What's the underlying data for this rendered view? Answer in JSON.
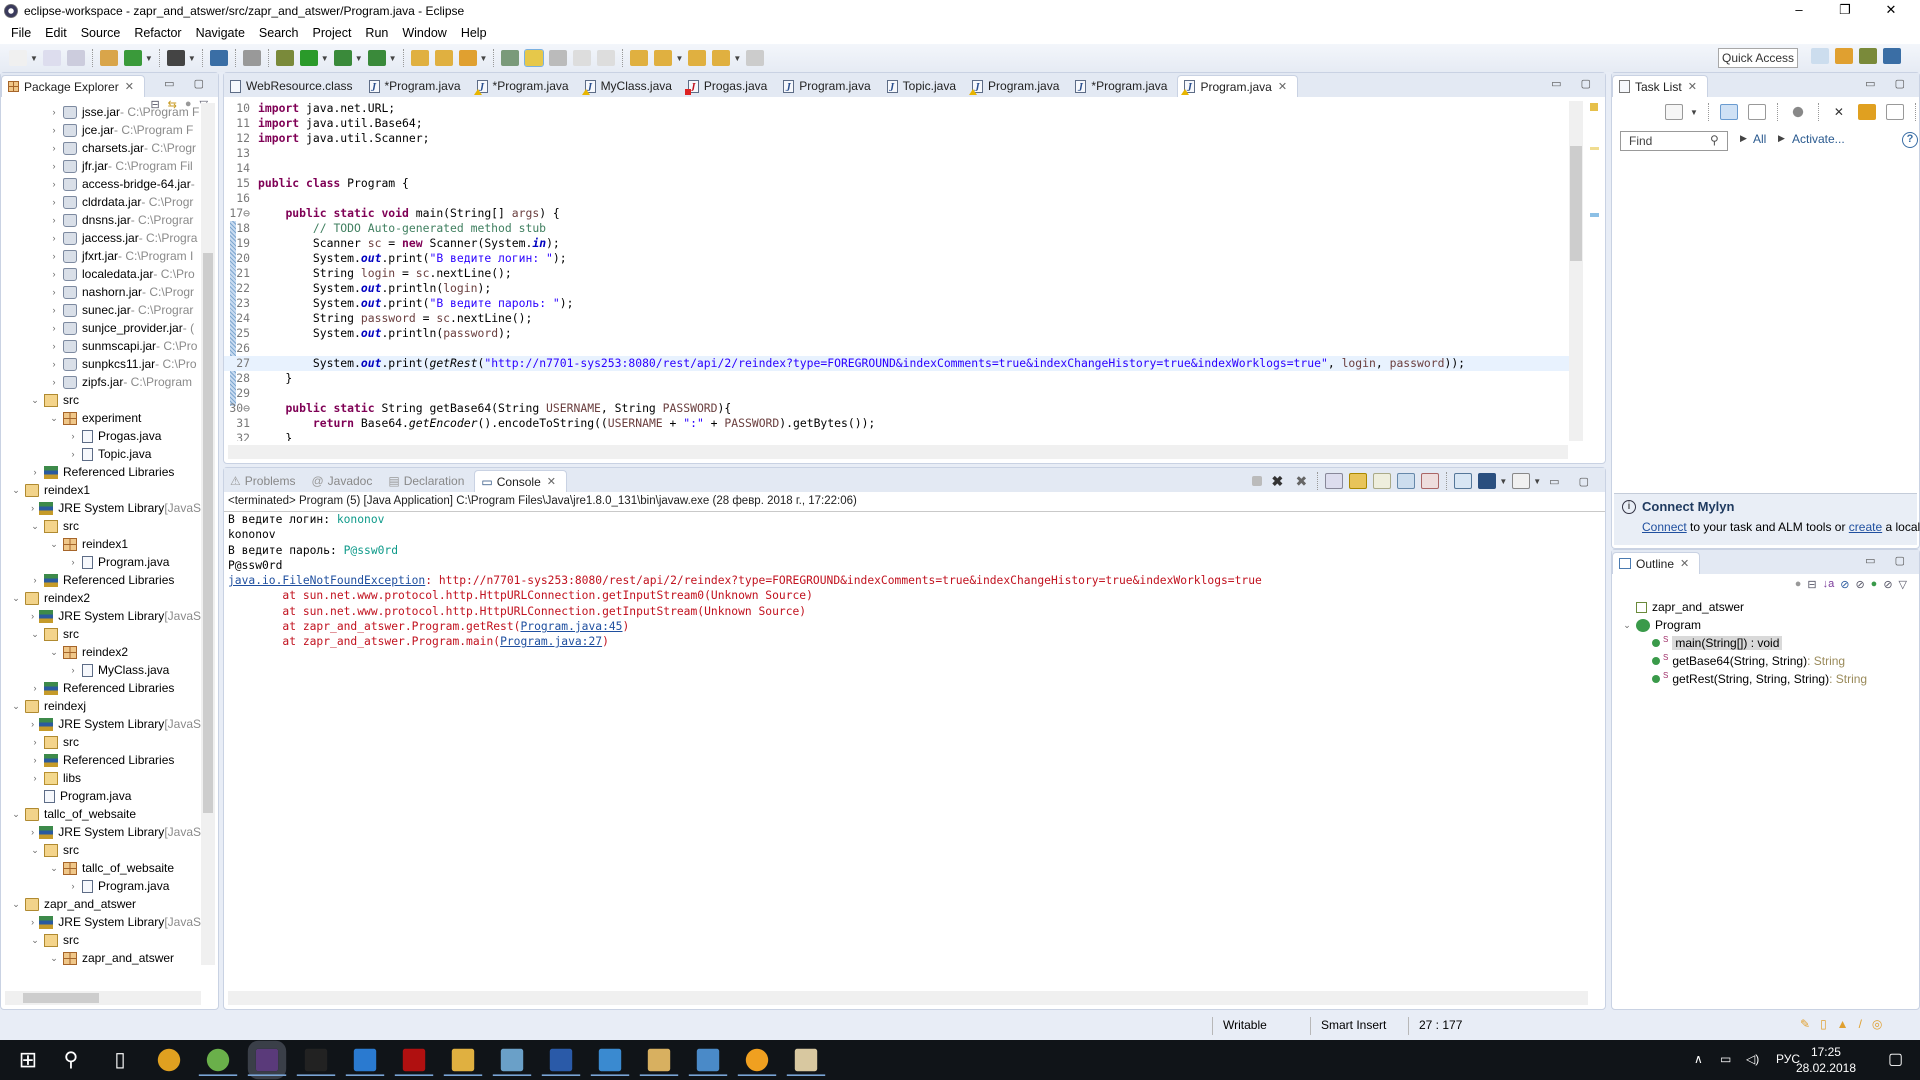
{
  "window": {
    "title": "eclipse-workspace - zapr_and_atswer/src/zapr_and_atswer/Program.java - Eclipse",
    "controls": {
      "minimize": "–",
      "maximize": "❐",
      "close": "✕"
    }
  },
  "menu": [
    "File",
    "Edit",
    "Source",
    "Refactor",
    "Navigate",
    "Search",
    "Project",
    "Run",
    "Window",
    "Help"
  ],
  "toolbar": {
    "quick_access": "Quick Access",
    "icons": [
      "new-icon",
      "save-icon",
      "save-all-icon",
      "new-package-icon",
      "new-class-icon",
      "profile-icon",
      "console-icon",
      "skip-breakpoints-icon",
      "debug-icon",
      "run-icon",
      "coverage-icon",
      "external-tools-icon",
      "open-type-icon",
      "open-task-icon",
      "search-icon",
      "annotation-icon",
      "mark-occurrences-icon",
      "show-whitespace-icon",
      "word-wrap-icon",
      "block-select-icon",
      "next-annotation-icon",
      "prev-annotation-icon",
      "last-edit-icon",
      "back-icon",
      "forward-icon"
    ],
    "perspectives": [
      "open-perspective-icon",
      "java-ee-icon",
      "debug-perspective-icon",
      "java-perspective-icon"
    ]
  },
  "package_explorer": {
    "title": "Package Explorer",
    "tree": [
      {
        "depth": 2,
        "arrow": "›",
        "icon": "jar",
        "label": "jsse.jar",
        "suffix": " - C:\\Program F"
      },
      {
        "depth": 2,
        "arrow": "›",
        "icon": "jar",
        "label": "jce.jar",
        "suffix": " - C:\\Program F"
      },
      {
        "depth": 2,
        "arrow": "›",
        "icon": "jar",
        "label": "charsets.jar",
        "suffix": " - C:\\Progr"
      },
      {
        "depth": 2,
        "arrow": "›",
        "icon": "jar",
        "label": "jfr.jar",
        "suffix": " - C:\\Program Fil"
      },
      {
        "depth": 2,
        "arrow": "›",
        "icon": "jar",
        "label": "access-bridge-64.jar",
        "suffix": " -"
      },
      {
        "depth": 2,
        "arrow": "›",
        "icon": "jar",
        "label": "cldrdata.jar",
        "suffix": " - C:\\Progr"
      },
      {
        "depth": 2,
        "arrow": "›",
        "icon": "jar",
        "label": "dnsns.jar",
        "suffix": " - C:\\Prograr"
      },
      {
        "depth": 2,
        "arrow": "›",
        "icon": "jar",
        "label": "jaccess.jar",
        "suffix": " - C:\\Progra"
      },
      {
        "depth": 2,
        "arrow": "›",
        "icon": "jar",
        "label": "jfxrt.jar",
        "suffix": " - C:\\Program I"
      },
      {
        "depth": 2,
        "arrow": "›",
        "icon": "jar",
        "label": "localedata.jar",
        "suffix": " - C:\\Pro"
      },
      {
        "depth": 2,
        "arrow": "›",
        "icon": "jar",
        "label": "nashorn.jar",
        "suffix": " - C:\\Progr"
      },
      {
        "depth": 2,
        "arrow": "›",
        "icon": "jar",
        "label": "sunec.jar",
        "suffix": " - C:\\Prograr"
      },
      {
        "depth": 2,
        "arrow": "›",
        "icon": "jar",
        "label": "sunjce_provider.jar",
        "suffix": " - ("
      },
      {
        "depth": 2,
        "arrow": "›",
        "icon": "jar",
        "label": "sunmscapi.jar",
        "suffix": " - C:\\Pro"
      },
      {
        "depth": 2,
        "arrow": "›",
        "icon": "jar",
        "label": "sunpkcs11.jar",
        "suffix": " - C:\\Pro"
      },
      {
        "depth": 2,
        "arrow": "›",
        "icon": "jar",
        "label": "zipfs.jar",
        "suffix": " - C:\\Program"
      },
      {
        "depth": 1,
        "arrow": "⌄",
        "icon": "src",
        "label": "src",
        "suffix": ""
      },
      {
        "depth": 2,
        "arrow": "⌄",
        "icon": "pkg",
        "label": "experiment",
        "suffix": ""
      },
      {
        "depth": 3,
        "arrow": "›",
        "icon": "java",
        "label": "Progas.java",
        "suffix": ""
      },
      {
        "depth": 3,
        "arrow": "›",
        "icon": "java",
        "label": "Topic.java",
        "suffix": ""
      },
      {
        "depth": 1,
        "arrow": "›",
        "icon": "lib",
        "label": "Referenced Libraries",
        "suffix": ""
      },
      {
        "depth": 0,
        "arrow": "⌄",
        "icon": "proj",
        "label": "reindex1",
        "suffix": ""
      },
      {
        "depth": 1,
        "arrow": "›",
        "icon": "lib",
        "label": "JRE System Library",
        "suffix": " [JavaS"
      },
      {
        "depth": 1,
        "arrow": "⌄",
        "icon": "src",
        "label": "src",
        "suffix": ""
      },
      {
        "depth": 2,
        "arrow": "⌄",
        "icon": "pkg",
        "label": "reindex1",
        "suffix": ""
      },
      {
        "depth": 3,
        "arrow": "›",
        "icon": "java",
        "label": "Program.java",
        "suffix": ""
      },
      {
        "depth": 1,
        "arrow": "›",
        "icon": "lib",
        "label": "Referenced Libraries",
        "suffix": ""
      },
      {
        "depth": 0,
        "arrow": "⌄",
        "icon": "proj",
        "label": "reindex2",
        "suffix": ""
      },
      {
        "depth": 1,
        "arrow": "›",
        "icon": "lib",
        "label": "JRE System Library",
        "suffix": " [JavaS"
      },
      {
        "depth": 1,
        "arrow": "⌄",
        "icon": "src",
        "label": "src",
        "suffix": ""
      },
      {
        "depth": 2,
        "arrow": "⌄",
        "icon": "pkg",
        "label": "reindex2",
        "suffix": ""
      },
      {
        "depth": 3,
        "arrow": "›",
        "icon": "java",
        "label": "MyClass.java",
        "suffix": ""
      },
      {
        "depth": 1,
        "arrow": "›",
        "icon": "lib",
        "label": "Referenced Libraries",
        "suffix": ""
      },
      {
        "depth": 0,
        "arrow": "⌄",
        "icon": "proj",
        "label": "reindexj",
        "suffix": ""
      },
      {
        "depth": 1,
        "arrow": "›",
        "icon": "lib",
        "label": "JRE System Library",
        "suffix": " [JavaS"
      },
      {
        "depth": 1,
        "arrow": "›",
        "icon": "src",
        "label": "src",
        "suffix": ""
      },
      {
        "depth": 1,
        "arrow": "›",
        "icon": "lib",
        "label": "Referenced Libraries",
        "suffix": ""
      },
      {
        "depth": 1,
        "arrow": "›",
        "icon": "folder",
        "label": "libs",
        "suffix": ""
      },
      {
        "depth": 1,
        "arrow": "",
        "icon": "java",
        "label": "Program.java",
        "suffix": ""
      },
      {
        "depth": 0,
        "arrow": "⌄",
        "icon": "proj",
        "label": "tallc_of_websaite",
        "suffix": ""
      },
      {
        "depth": 1,
        "arrow": "›",
        "icon": "lib",
        "label": "JRE System Library",
        "suffix": " [JavaS"
      },
      {
        "depth": 1,
        "arrow": "⌄",
        "icon": "src",
        "label": "src",
        "suffix": ""
      },
      {
        "depth": 2,
        "arrow": "⌄",
        "icon": "pkg",
        "label": "tallc_of_websaite",
        "suffix": ""
      },
      {
        "depth": 3,
        "arrow": "›",
        "icon": "java",
        "label": "Program.java",
        "suffix": ""
      },
      {
        "depth": 0,
        "arrow": "⌄",
        "icon": "proj",
        "label": "zapr_and_atswer",
        "suffix": ""
      },
      {
        "depth": 1,
        "arrow": "›",
        "icon": "lib",
        "label": "JRE System Library",
        "suffix": " [JavaS"
      },
      {
        "depth": 1,
        "arrow": "⌄",
        "icon": "src",
        "label": "src",
        "suffix": ""
      },
      {
        "depth": 2,
        "arrow": "⌄",
        "icon": "pkg",
        "label": "zapr_and_atswer",
        "suffix": ""
      }
    ]
  },
  "editor": {
    "tabs": [
      {
        "label": "WebResource.class",
        "icon": "class",
        "dirty": false,
        "active": false
      },
      {
        "label": "*Program.java",
        "icon": "java",
        "active": false
      },
      {
        "label": "*Program.java",
        "icon": "java-warn",
        "active": false
      },
      {
        "label": "MyClass.java",
        "icon": "java-warn",
        "active": false
      },
      {
        "label": "Progas.java",
        "icon": "java-err",
        "active": false
      },
      {
        "label": "Program.java",
        "icon": "java",
        "active": false
      },
      {
        "label": "Topic.java",
        "icon": "java",
        "active": false
      },
      {
        "label": "Program.java",
        "icon": "java-warn",
        "active": false
      },
      {
        "label": "*Program.java",
        "icon": "java",
        "active": false
      },
      {
        "label": "Program.java",
        "icon": "java-warn",
        "active": true
      }
    ],
    "lines": [
      {
        "n": "10",
        "html": "<span class='kw'>import</span> java.net.URL;"
      },
      {
        "n": "11",
        "html": "<span class='kw'>import</span> java.util.Base64;"
      },
      {
        "n": "12",
        "html": "<span class='kw'>import</span> java.util.Scanner;"
      },
      {
        "n": "13",
        "html": ""
      },
      {
        "n": "14",
        "html": ""
      },
      {
        "n": "15",
        "html": "<span class='kw'>public class</span> Program {"
      },
      {
        "n": "16",
        "html": ""
      },
      {
        "n": "17⊖",
        "html": "    <span class='kw'>public static void</span> main(String[] <span class='var'>args</span>) {"
      },
      {
        "n": "18",
        "html": "        <span class='cm'>// TODO Auto-generated method stub</span>"
      },
      {
        "n": "19",
        "html": "        Scanner <span class='var'>sc</span> = <span class='kw'>new</span> Scanner(System.<span class='fld'>in</span>);"
      },
      {
        "n": "20",
        "html": "        System.<span class='fld'>out</span>.print(<span class='str'>\"В ведите логин: \"</span>);"
      },
      {
        "n": "21",
        "html": "        String <span class='var'>login</span> = <span class='var'>sc</span>.nextLine();"
      },
      {
        "n": "22",
        "html": "        System.<span class='fld'>out</span>.println(<span class='var'>login</span>);"
      },
      {
        "n": "23",
        "html": "        System.<span class='fld'>out</span>.print(<span class='str'>\"В ведите пароль: \"</span>);"
      },
      {
        "n": "24",
        "html": "        String <span class='var'>password</span> = <span class='var'>sc</span>.nextLine();"
      },
      {
        "n": "25",
        "html": "        System.<span class='fld'>out</span>.println(<span class='var'>password</span>);"
      },
      {
        "n": "26",
        "html": ""
      },
      {
        "n": "27",
        "cur": true,
        "html": "        System.<span class='fld'>out</span>.print(<span class='it'>getRest</span>(<span class='str'>\"http://n7701-sys253:8080/rest/api/2/reindex?type=FOREGROUND&amp;indexComments=true&amp;indexChangeHistory=true&amp;indexWorklogs=true\"</span>, <span class='var'>login</span>, <span class='var'>password</span>));"
      },
      {
        "n": "28",
        "html": "    }"
      },
      {
        "n": "29",
        "html": ""
      },
      {
        "n": "30⊖",
        "html": "    <span class='kw'>public static</span> String getBase64(String <span class='var'>USERNAME</span>, String <span class='var'>PASSWORD</span>){"
      },
      {
        "n": "31",
        "html": "        <span class='kw'>return</span> Base64.<span class='it'>getEncoder</span>().encodeToString((<span class='var'>USERNAME</span> + <span class='str'>\":\"</span> + <span class='var'>PASSWORD</span>).getBytes());"
      },
      {
        "n": "32",
        "html": "    }"
      }
    ]
  },
  "bottom_panel": {
    "tabs": [
      "Problems",
      "Javadoc",
      "Declaration",
      "Console"
    ],
    "active_tab": "Console",
    "header": "<terminated> Program (5) [Java Application] C:\\Program Files\\Java\\jre1.8.0_131\\bin\\javaw.exe (28 февр. 2018 г., 17:22:06)",
    "output": [
      {
        "parts": [
          {
            "t": "В ведите логин: ",
            "c": ""
          },
          {
            "t": "kononov",
            "c": "in"
          }
        ]
      },
      {
        "parts": [
          {
            "t": "kononov",
            "c": ""
          }
        ]
      },
      {
        "parts": [
          {
            "t": "В ведите пароль: ",
            "c": ""
          },
          {
            "t": "P@ssw0rd",
            "c": "in"
          }
        ]
      },
      {
        "parts": [
          {
            "t": "P@ssw0rd",
            "c": ""
          }
        ]
      },
      {
        "parts": [
          {
            "t": "java.io.FileNotFoundException",
            "c": "link"
          },
          {
            "t": ": http://n7701-sys253:8080/rest/api/2/reindex?type=FOREGROUND&indexComments=true&indexChangeHistory=true&indexWorklogs=true",
            "c": "err"
          }
        ]
      },
      {
        "parts": [
          {
            "t": "\tat sun.net.www.protocol.http.HttpURLConnection.getInputStream0(Unknown Source)",
            "c": "err"
          }
        ]
      },
      {
        "parts": [
          {
            "t": "\tat sun.net.www.protocol.http.HttpURLConnection.getInputStream(Unknown Source)",
            "c": "err"
          }
        ]
      },
      {
        "parts": [
          {
            "t": "\tat zapr_and_atswer.Program.getRest(",
            "c": "err"
          },
          {
            "t": "Program.java:45",
            "c": "link"
          },
          {
            "t": ")",
            "c": "err"
          }
        ]
      },
      {
        "parts": [
          {
            "t": "\tat zapr_and_atswer.Program.main(",
            "c": "err"
          },
          {
            "t": "Program.java:27",
            "c": "link"
          },
          {
            "t": ")",
            "c": "err"
          }
        ]
      }
    ]
  },
  "task_list": {
    "title": "Task List",
    "find_placeholder": "Find",
    "all_label": "All",
    "activate_label": "Activate...",
    "mylyn_title": "Connect Mylyn",
    "mylyn_connect": "Connect",
    "mylyn_mid": " to your task and ALM tools or ",
    "mylyn_create": "create",
    "mylyn_tail": " a local"
  },
  "outline": {
    "title": "Outline",
    "items": [
      {
        "depth": 0,
        "label": "zapr_and_atswer",
        "type": "",
        "icon": "package"
      },
      {
        "depth": 0,
        "label": "Program",
        "type": "",
        "icon": "class",
        "expanded": true
      },
      {
        "depth": 1,
        "label": "main(String[]) : void",
        "type": "",
        "icon": "method",
        "selected": true
      },
      {
        "depth": 1,
        "label": "getBase64(String, String)",
        "type": " : String",
        "icon": "method"
      },
      {
        "depth": 1,
        "label": "getRest(String, String, String)",
        "type": " : String",
        "icon": "method"
      }
    ]
  },
  "status_bar": {
    "writable": "Writable",
    "insert_mode": "Smart Insert",
    "position": "27 : 177"
  },
  "taskbar": {
    "apps": [
      "start-icon",
      "search-icon",
      "task-view-icon",
      "chrome-icon",
      "spring-icon",
      "eclipse-icon",
      "cmd-icon",
      "outlook-icon",
      "acrobat-icon",
      "explorer-icon",
      "notepad-icon",
      "word-icon",
      "ie-icon",
      "folder-icon",
      "media-icon",
      "app-icon",
      "paint-icon"
    ],
    "lang": "РУС",
    "time": "17:25",
    "date": "28.02.2018"
  },
  "colors": {
    "keyword": "#7f0055",
    "string": "#2a00ff",
    "comment": "#3f7f5f",
    "error": "#c1121f",
    "input": "#0e9a8a",
    "link": "#1f4f9f"
  }
}
